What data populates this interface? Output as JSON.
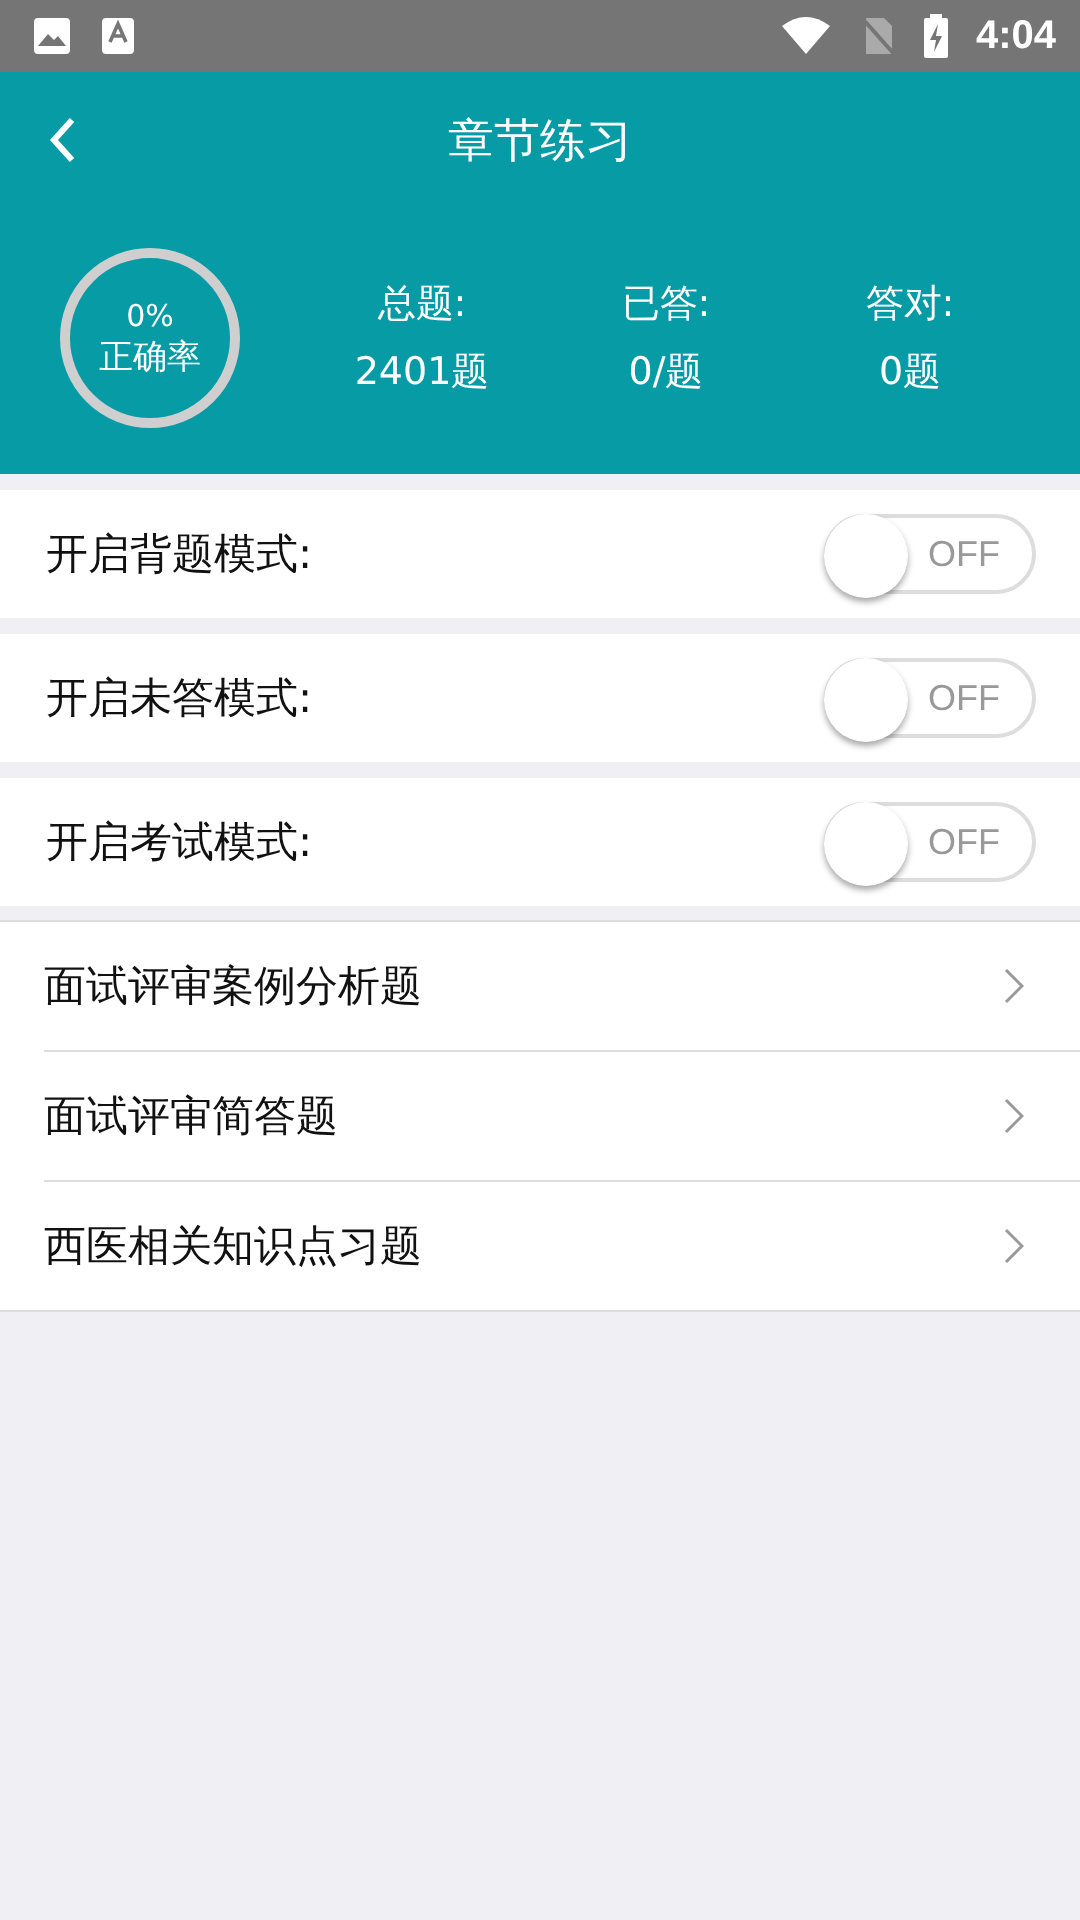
{
  "status_bar": {
    "time": "4:04"
  },
  "header": {
    "title": "章节练习"
  },
  "summary": {
    "accuracy": "0%",
    "accuracy_label": "正确率",
    "stats": [
      {
        "label": "总题:",
        "value": "2401题"
      },
      {
        "label": "已答:",
        "value": "0/题"
      },
      {
        "label": "答对:",
        "value": "0题"
      }
    ]
  },
  "toggles": [
    {
      "label": "开启背题模式:",
      "on": false,
      "text": "OFF"
    },
    {
      "label": "开启未答模式:",
      "on": false,
      "text": "OFF"
    },
    {
      "label": "开启考试模式:",
      "on": false,
      "text": "OFF"
    }
  ],
  "chapters": [
    {
      "label": "面试评审案例分析题"
    },
    {
      "label": "面试评审简答题"
    },
    {
      "label": "西医相关知识点习题"
    }
  ]
}
